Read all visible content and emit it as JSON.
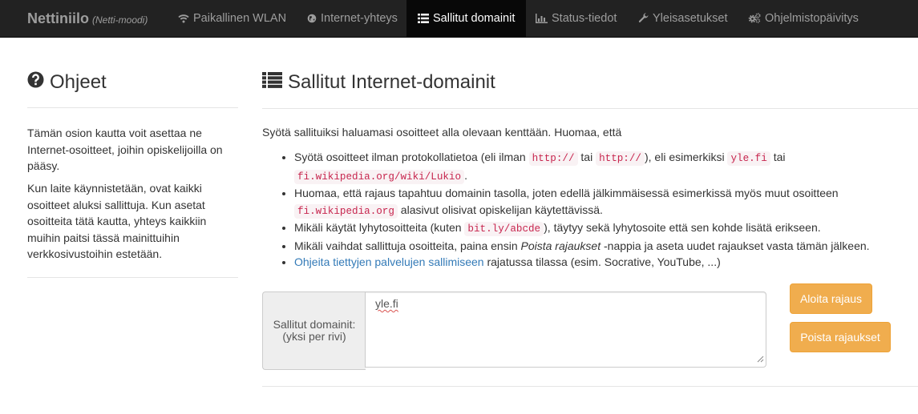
{
  "navbar": {
    "brand": "Nettiniilo",
    "brand_sub": "(Netti-moodi)",
    "items": [
      {
        "label": "Paikallinen WLAN",
        "icon": "wifi-icon"
      },
      {
        "label": "Internet-yhteys",
        "icon": "globe-icon"
      },
      {
        "label": "Sallitut domainit",
        "icon": "list-icon",
        "active": true
      },
      {
        "label": "Status-tiedot",
        "icon": "bar-chart-icon"
      },
      {
        "label": "Yleisasetukset",
        "icon": "wrench-icon"
      },
      {
        "label": "Ohjelmistopäivitys",
        "icon": "cogs-icon"
      }
    ]
  },
  "help": {
    "title": "Ohjeet",
    "icon": "question-circle-icon",
    "p1": "Tämän osion kautta voit asettaa ne Internet-osoitteet, joihin opiskelijoilla on pääsy.",
    "p2": "Kun laite käynnistetään, ovat kaikki osoitteet aluksi sallittuja. Kun asetat osoitteita tätä kautta, yhteys kaikkiin muihin paitsi tässä mainittuihin verkkosivustoihin estetään."
  },
  "main": {
    "title": "Sallitut Internet-domainit",
    "icon": "list-icon",
    "intro": "Syötä sallituiksi haluamasi osoitteet alla olevaan kenttään. Huomaa, että",
    "rules": {
      "r1_a": "Syötä osoitteet ilman protokollatietoa (eli ilman ",
      "r1_code1": "http://",
      "r1_b": " tai ",
      "r1_code2": "http://",
      "r1_c": "), eli esimerkiksi ",
      "r1_code3": "yle.fi",
      "r1_d": " tai ",
      "r1_code4": "fi.wikipedia.org/wiki/Lukio",
      "r1_e": ".",
      "r2_a": "Huomaa, että rajaus tapahtuu domainin tasolla, joten edellä jälkimmäisessä esimerkissä myös muut osoitteen ",
      "r2_code": "fi.wikipedia.org",
      "r2_b": " alasivut olisivat opiskelijan käytettävissä.",
      "r3_a": "Mikäli käytät lyhytosoitteita (kuten ",
      "r3_code": "bit.ly/abcde",
      "r3_b": "), täytyy sekä lyhytosoite että sen kohde lisätä erikseen.",
      "r4_a": "Mikäli vaihdat sallittuja osoitteita, paina ensin ",
      "r4_em": "Poista rajaukset",
      "r4_b": " -nappia ja aseta uudet rajaukset vasta tämän jälkeen.",
      "r5_link": "Ohjeita tiettyjen palvelujen sallimiseen",
      "r5_b": " rajatussa tilassa (esim. Socrative, YouTube, ...)"
    },
    "form": {
      "label_line1": "Sallitut domainit:",
      "label_line2": "(yksi per rivi)",
      "value": "yle.fi"
    },
    "buttons": {
      "start": "Aloita rajaus",
      "clear": "Poista rajaukset"
    }
  },
  "colors": {
    "navbar_bg": "#222222",
    "accent_warning": "#f0ad4e",
    "link": "#337ab7",
    "code_fg": "#c7254e",
    "code_bg": "#f9f2f4"
  }
}
